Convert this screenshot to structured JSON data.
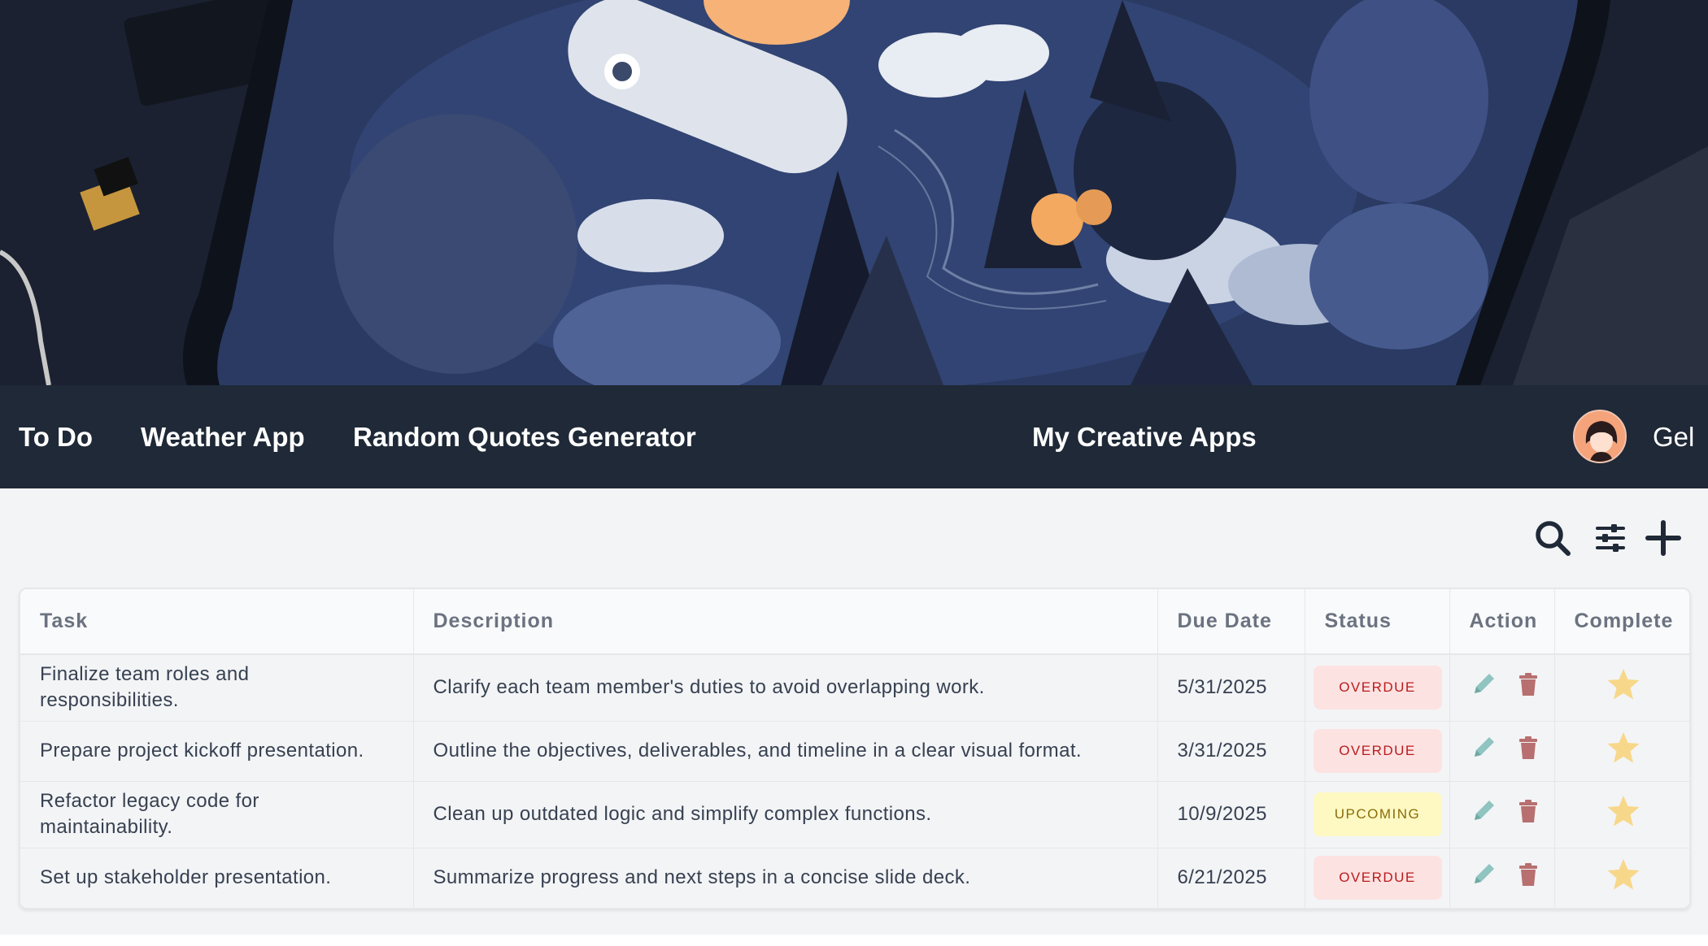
{
  "nav": {
    "links": [
      {
        "label": "To Do"
      },
      {
        "label": "Weather App"
      },
      {
        "label": "Random Quotes Generator"
      }
    ],
    "title": "My Creative Apps",
    "user": {
      "name": "Gel"
    }
  },
  "toolbar": {
    "icons": [
      "search-icon",
      "filter-sliders-icon",
      "add-icon"
    ]
  },
  "table": {
    "headers": {
      "task": "Task",
      "description": "Description",
      "due_date": "Due Date",
      "status": "Status",
      "action": "Action",
      "complete": "Complete"
    },
    "rows": [
      {
        "task": "Finalize team roles and responsibilities.",
        "description": "Clarify each team member's duties to avoid overlapping work.",
        "due_date": "5/31/2025",
        "status": "OVERDUE"
      },
      {
        "task": "Prepare project kickoff presentation.",
        "description": "Outline the objectives, deliverables, and timeline in a clear visual format.",
        "due_date": "3/31/2025",
        "status": "OVERDUE"
      },
      {
        "task": "Refactor legacy code for maintainability.",
        "description": "Clean up outdated logic and simplify complex functions.",
        "due_date": "10/9/2025",
        "status": "UPCOMING"
      },
      {
        "task": "Set up stakeholder presentation.",
        "description": "Summarize progress and next steps in a concise slide deck.",
        "due_date": "6/21/2025",
        "status": "OVERDUE"
      }
    ]
  },
  "colors": {
    "nav_bg": "#1f2937",
    "overdue_bg": "#fde2e2",
    "overdue_text": "#b91c1c",
    "upcoming_bg": "#fef9c3",
    "upcoming_text": "#8a6d0b",
    "edit_icon": "#8fc4c0",
    "delete_icon": "#b86f6f",
    "star": "#f7d88a"
  }
}
